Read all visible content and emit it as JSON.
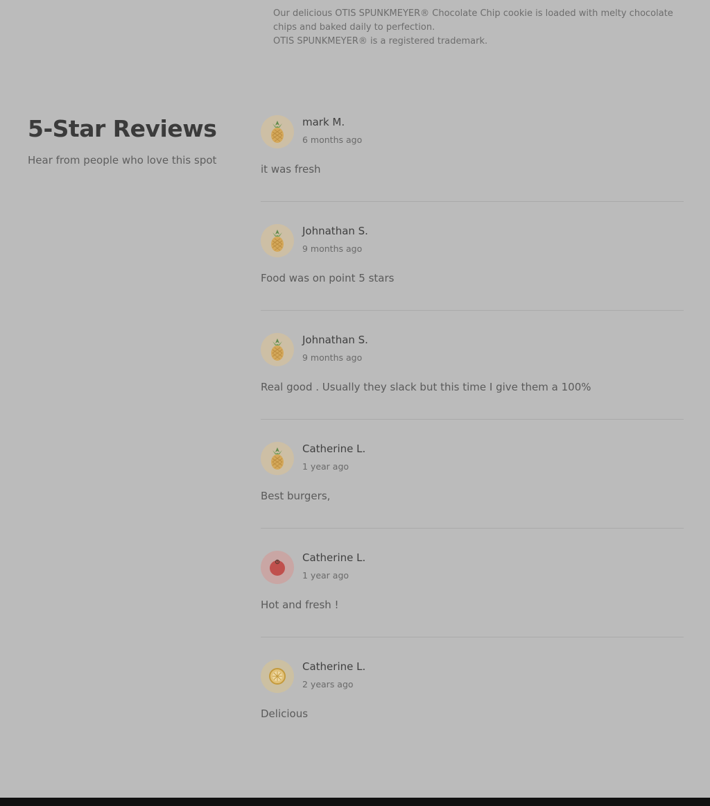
{
  "product": {
    "description": "Our delicious OTIS SPUNKMEYER® Chocolate Chip cookie is loaded with melty chocolate chips and baked daily to perfection.",
    "trademark": "OTIS SPUNKMEYER® is a registered trademark."
  },
  "reviews_section": {
    "title": "5-Star Reviews",
    "subtitle": "Hear from people who love this spot",
    "reviews": [
      {
        "name": "mark M.",
        "time": "6 months ago",
        "text": "it was fresh",
        "avatar_icon": "pineapple-icon"
      },
      {
        "name": "Johnathan S.",
        "time": "9 months ago",
        "text": "Food was on point 5 stars",
        "avatar_icon": "pineapple-icon"
      },
      {
        "name": "Johnathan S.",
        "time": "9 months ago",
        "text": "Real good . Usually they slack but this time I give them a 100%",
        "avatar_icon": "pineapple-icon"
      },
      {
        "name": "Catherine L.",
        "time": "1 year ago",
        "text": "Best burgers,",
        "avatar_icon": "pineapple-icon"
      },
      {
        "name": "Catherine L.",
        "time": "1 year ago",
        "text": "Hot and fresh !",
        "avatar_icon": "apple-icon"
      },
      {
        "name": "Catherine L.",
        "time": "2 years ago",
        "text": "Delicious",
        "avatar_icon": "lemon-icon"
      }
    ]
  },
  "colors": {
    "page_background": "#bbbbbb",
    "footer": "#111111",
    "pineapple_avatar_bg": "#cdbfa5",
    "apple_avatar_bg": "#c9a6a4",
    "lemon_avatar_bg": "#ccc0a2"
  }
}
